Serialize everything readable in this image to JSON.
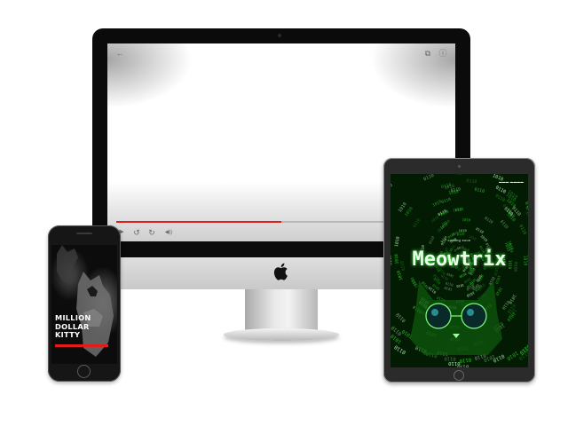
{
  "desktop_player": {
    "icons": {
      "back": "back-arrow-icon",
      "cast": "cast-icon",
      "info": "info-icon",
      "play": "play-icon",
      "rewind": "rewind-10-icon",
      "forward": "forward-10-icon",
      "volume": "volume-icon"
    },
    "glyphs": {
      "back": "←",
      "cast": "⧉",
      "info": "ⓘ",
      "play": "▶",
      "rewind": "↺",
      "forward": "↻",
      "volume": "◀))"
    },
    "progress": 0.5,
    "progress_color": "#e31b1b"
  },
  "phone_poster": {
    "title": "MILLION DOLLAR KITTY",
    "subtitle_color": "#e31b1b"
  },
  "tablet_poster": {
    "coming_soon": "coming soon",
    "title": "Meowtrix",
    "accent": "#2bd62b"
  },
  "colors": {
    "matrix_green": "#1a8f1a",
    "bezel": "#0b0b0b"
  }
}
